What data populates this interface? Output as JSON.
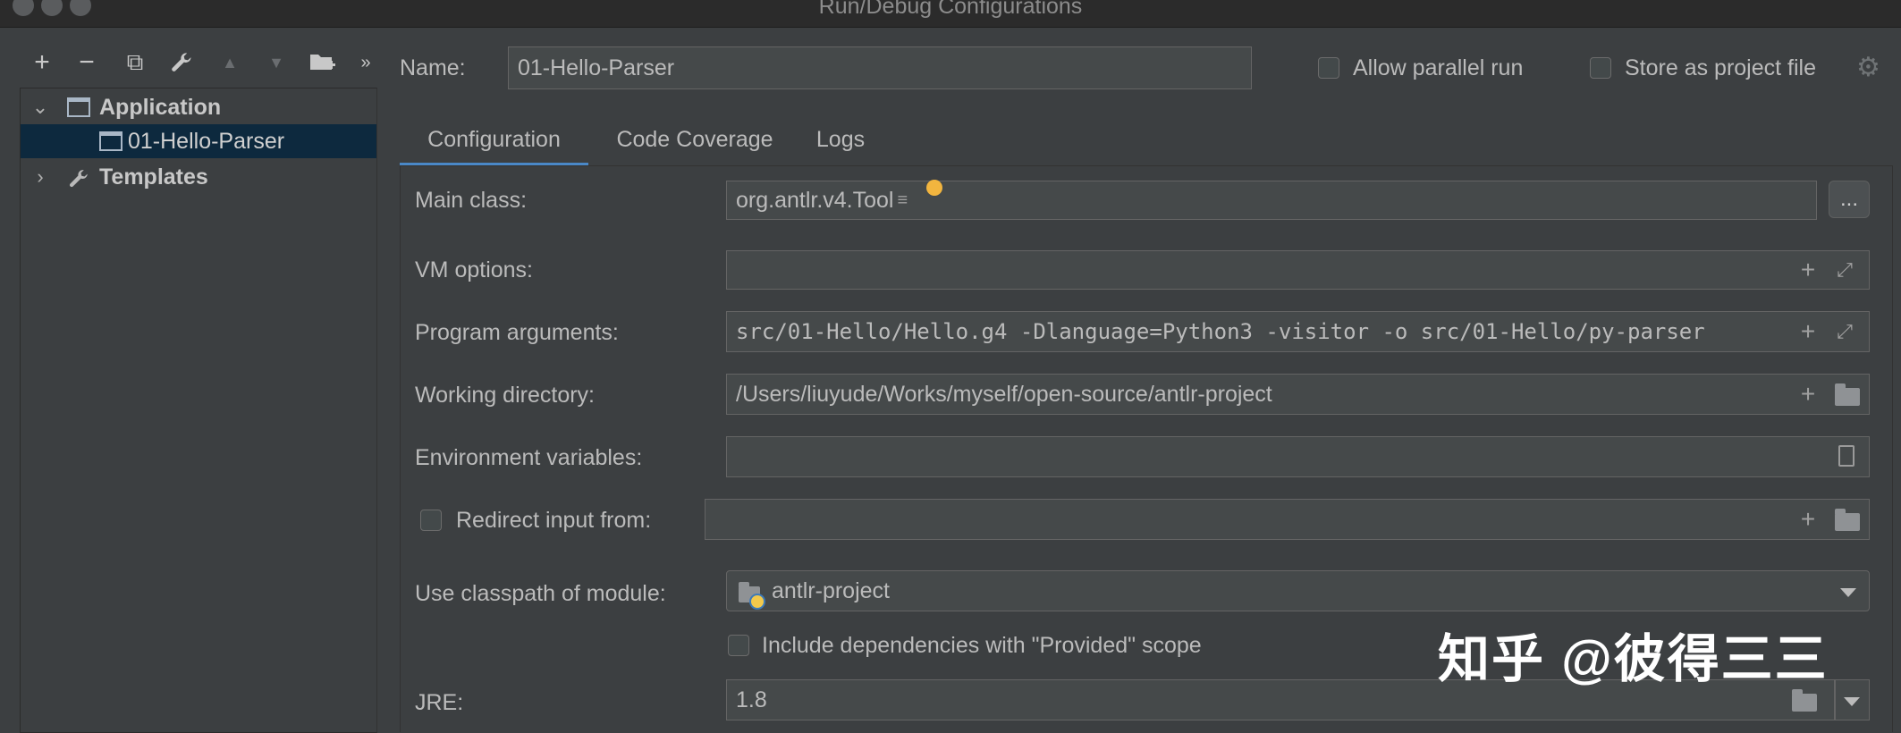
{
  "window": {
    "title": "Run/Debug Configurations"
  },
  "toolbar": {
    "icons": [
      "add-icon",
      "remove-icon",
      "copy-icon",
      "wrench-icon",
      "move-up-icon",
      "move-down-icon",
      "new-folder-icon",
      "more-icon"
    ],
    "symbols": {
      "add": "+",
      "remove": "−",
      "copy": "⧉",
      "wrench": "🔧",
      "up": "▲",
      "down": "▼",
      "folder": "⊞",
      "more": "»"
    }
  },
  "tree": {
    "application_label": "Application",
    "config_label": "01-Hello-Parser",
    "templates_label": "Templates"
  },
  "header": {
    "name_label": "Name:",
    "name_value": "01-Hello-Parser",
    "allow_parallel_label": "Allow parallel run",
    "store_project_label": "Store as project file"
  },
  "tabs": [
    {
      "label": "Configuration",
      "active": true
    },
    {
      "label": "Code Coverage",
      "active": false
    },
    {
      "label": "Logs",
      "active": false
    }
  ],
  "form": {
    "main_class_label": "Main class:",
    "main_class_value": "org.antlr.v4.Tool",
    "browse_label": "...",
    "vm_options_label": "VM options:",
    "vm_options_value": "",
    "program_args_label": "Program arguments:",
    "program_args_value": "src/01-Hello/Hello.g4 -Dlanguage=Python3 -visitor -o src/01-Hello/py-parser",
    "working_dir_label": "Working directory:",
    "working_dir_value": "/Users/liuyude/Works/myself/open-source/antlr-project",
    "env_vars_label": "Environment variables:",
    "env_vars_value": "",
    "redirect_label": "Redirect input from:",
    "redirect_value": "",
    "classpath_label": "Use classpath of module:",
    "classpath_value": "antlr-project",
    "include_deps_label": "Include dependencies with \"Provided\" scope",
    "jre_label": "JRE:",
    "jre_value": "1.8"
  },
  "watermark": "知乎 @彼得三三",
  "colors": {
    "accent": "#4a88c7",
    "background": "#3c3f41",
    "field": "#45494a",
    "selection": "#0d293e",
    "bulb": "#f2b53f"
  }
}
